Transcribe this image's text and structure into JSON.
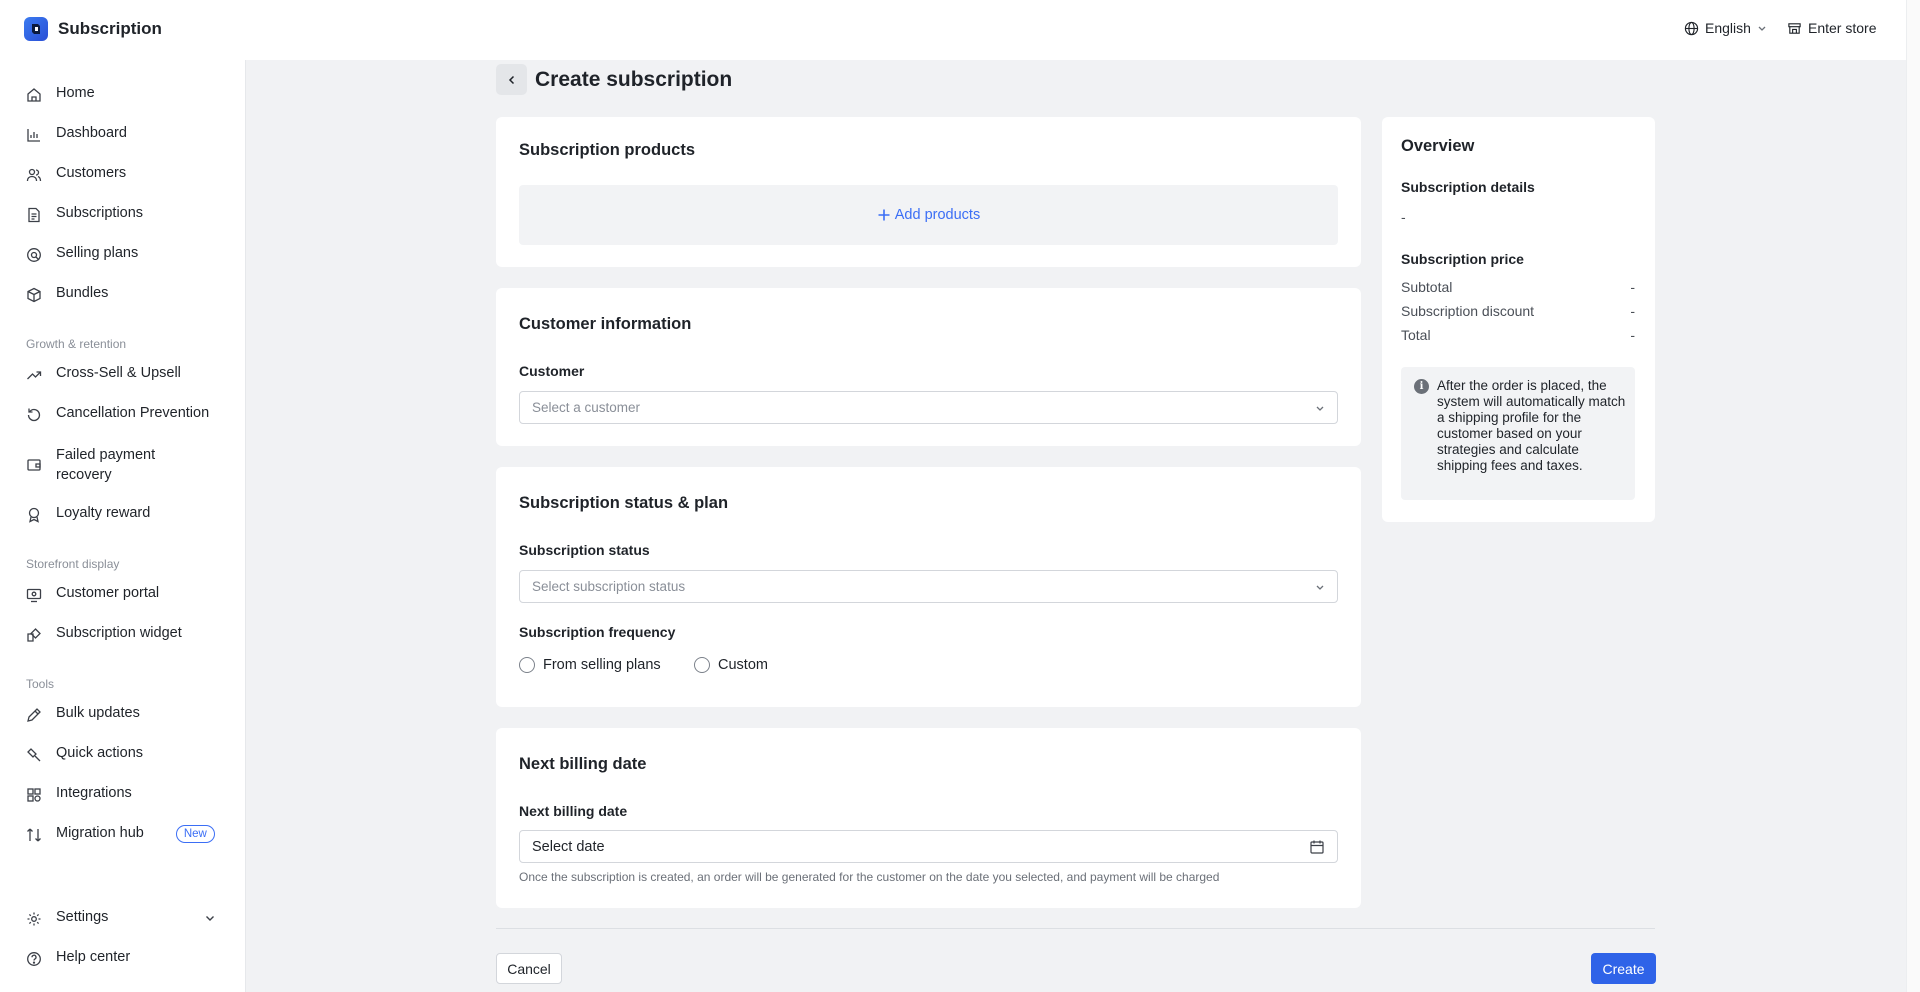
{
  "header": {
    "app_title": "Subscription",
    "language": "English",
    "enter_store": "Enter store"
  },
  "sidebar": {
    "items": [
      {
        "label": "Home",
        "icon": "home-icon"
      },
      {
        "label": "Dashboard",
        "icon": "chart-icon"
      },
      {
        "label": "Customers",
        "icon": "users-icon"
      },
      {
        "label": "Subscriptions",
        "icon": "document-icon"
      },
      {
        "label": "Selling plans",
        "icon": "selling-plan-icon"
      },
      {
        "label": "Bundles",
        "icon": "box-icon"
      }
    ],
    "growth_section": "Growth & retention",
    "growth_items": [
      {
        "label": "Cross-Sell & Upsell",
        "icon": "trend-up-icon"
      },
      {
        "label": "Cancellation Prevention",
        "icon": "refresh-icon"
      },
      {
        "label": "Failed payment recovery",
        "line1": "Failed payment",
        "line2": "recovery",
        "icon": "wallet-icon"
      },
      {
        "label": "Loyalty reward",
        "icon": "medal-icon"
      }
    ],
    "storefront_section": "Storefront display",
    "storefront_items": [
      {
        "label": "Customer portal",
        "icon": "portal-icon"
      },
      {
        "label": "Subscription widget",
        "icon": "widget-icon"
      }
    ],
    "tools_section": "Tools",
    "tools_items": [
      {
        "label": "Bulk updates",
        "icon": "edit-icon"
      },
      {
        "label": "Quick actions",
        "icon": "link-icon"
      },
      {
        "label": "Integrations",
        "icon": "grid-icon"
      },
      {
        "label": "Migration hub",
        "icon": "migration-icon",
        "badge": "New"
      }
    ],
    "settings": "Settings",
    "help": "Help center"
  },
  "page": {
    "title": "Create subscription"
  },
  "products_card": {
    "title": "Subscription products",
    "add_label": "Add products"
  },
  "customer_card": {
    "title": "Customer information",
    "field_label": "Customer",
    "placeholder": "Select a customer"
  },
  "status_card": {
    "title": "Subscription status & plan",
    "status_label": "Subscription status",
    "status_placeholder": "Select subscription status",
    "frequency_label": "Subscription frequency",
    "options": [
      "From selling plans",
      "Custom"
    ]
  },
  "billing_card": {
    "title": "Next billing date",
    "field_label": "Next billing date",
    "placeholder": "Select date",
    "hint": "Once the subscription is created, an order will be generated for the customer on the date you selected, and payment will be charged"
  },
  "overview": {
    "title": "Overview",
    "details_label": "Subscription details",
    "details_value": "-",
    "price_label": "Subscription price",
    "rows": [
      {
        "label": "Subtotal",
        "value": "-"
      },
      {
        "label": "Subscription discount",
        "value": "-"
      },
      {
        "label": "Total",
        "value": "-"
      }
    ],
    "info": "After the order is placed, the system will automatically match a shipping profile for the customer based on your strategies and calculate shipping fees and taxes."
  },
  "footer": {
    "cancel": "Cancel",
    "create": "Create"
  },
  "colors": {
    "accent": "#2f63e8",
    "link": "#3b6ef5",
    "background": "#f1f2f4"
  }
}
